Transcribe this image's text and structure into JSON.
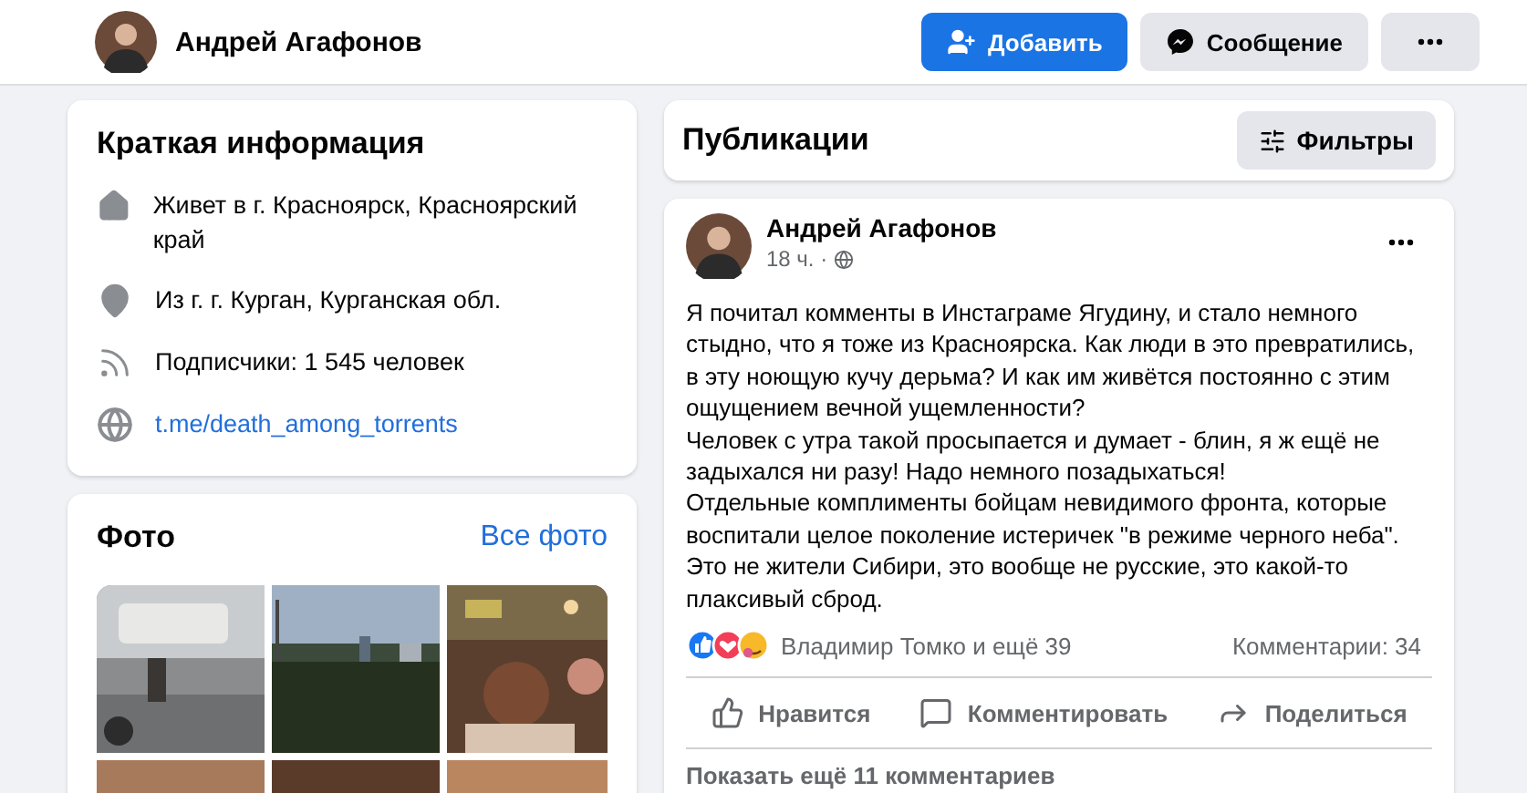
{
  "header": {
    "name": "Андрей Агафонов",
    "buttons": [
      {
        "kind": "add",
        "label": "Добавить"
      },
      {
        "kind": "message",
        "label": "Сообщение"
      },
      {
        "kind": "more"
      }
    ]
  },
  "intro": {
    "title": "Краткая информация",
    "items": [
      {
        "kind": "home",
        "text": "Живет в г. Красноярск, Красноярский край"
      },
      {
        "kind": "location",
        "text": "Из г. г. Курган, Курганская обл."
      },
      {
        "kind": "followers",
        "text": "Подписчики: 1 545 человек"
      },
      {
        "kind": "link",
        "text": "t.me/death_among_torrents"
      }
    ]
  },
  "photos": {
    "title": "Фото",
    "link": "Все фото"
  },
  "posts_header": {
    "title": "Публикации",
    "filter_button": "Фильтры"
  },
  "post": {
    "author": "Андрей Агафонов",
    "time": "18 ч. ·",
    "text": "Я почитал комменты в Инстаграме Ягудину, и стало немного стыдно, что я тоже из Красноярска. Как люди в это превратились, в эту ноющую кучу дерьма? И как им живётся постоянно с этим ощущением вечной ущемленности?\nЧеловек с утра такой просыпается и думает - блин, я ж ещё не задыхался ни разу! Надо немного позадыхаться!\nОтдельные комплименты бойцам невидимого фронта, которые воспитали целое поколение истеричек \"в режиме черного неба\". Это не жители Сибири, это вообще не русские, это какой-то плаксивый сброд.",
    "reactions": "Владимир Томко и ещё 39",
    "comments": "Комментарии: 34",
    "actions": [
      {
        "kind": "like",
        "label": "Нравится"
      },
      {
        "kind": "comment",
        "label": "Комментировать"
      },
      {
        "kind": "share",
        "label": "Поделиться"
      }
    ],
    "more_comments": "Показать ещё 11 комментариев"
  }
}
